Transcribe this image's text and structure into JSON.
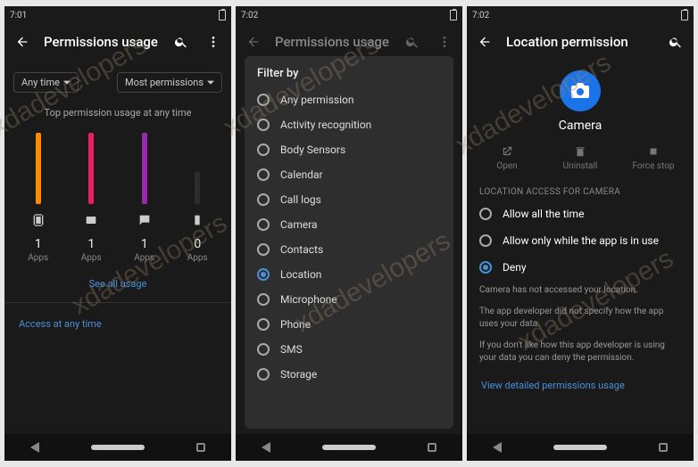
{
  "screen1": {
    "time": "7:01",
    "title": "Permissions usage",
    "dd1": "Any time",
    "dd2": "Most permissions",
    "caption": "Top permission usage at any time",
    "counts": [
      "1",
      "1",
      "1",
      "0"
    ],
    "apps_label": "Apps",
    "see_all": "See all usage",
    "access": "Access at any time"
  },
  "screen2": {
    "time": "7:02",
    "title": "Permissions usage",
    "filter_title": "Filter by",
    "options": [
      "Any permission",
      "Activity recognition",
      "Body Sensors",
      "Calendar",
      "Call logs",
      "Camera",
      "Contacts",
      "Location",
      "Microphone",
      "Phone",
      "SMS",
      "Storage"
    ],
    "selected": "Location"
  },
  "screen3": {
    "time": "7:02",
    "title": "Location permission",
    "app_name": "Camera",
    "actions": [
      "Open",
      "Uninstall",
      "Force stop"
    ],
    "section": "LOCATION ACCESS FOR CAMERA",
    "choices": [
      "Allow all the time",
      "Allow only while the app is in use",
      "Deny"
    ],
    "selected": "Deny",
    "note1": "Camera has not accessed your location.",
    "note2": "The app developer did not specify how the app uses your data.",
    "note3": "If you don't like how this app developer is using your data you can deny the permission.",
    "link": "View detailed permissions usage"
  }
}
